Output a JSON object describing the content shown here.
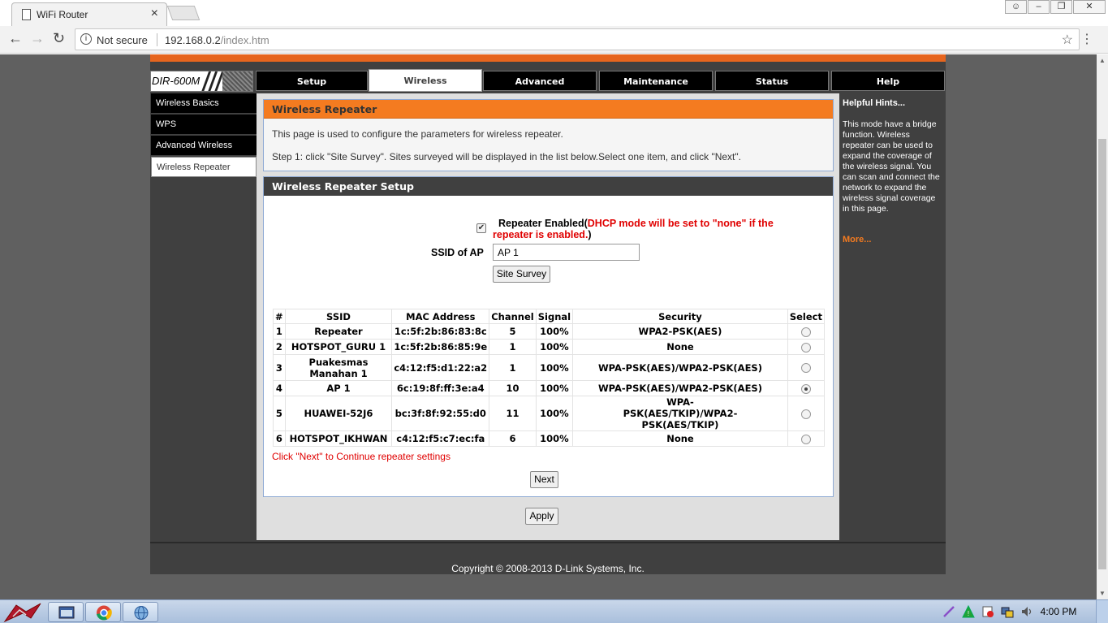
{
  "browser": {
    "tab_title": "WiFi Router",
    "tab_close": "×",
    "not_secure": "Not secure",
    "url_host": "192.168.0.2",
    "url_path": "/index.htm"
  },
  "router": {
    "model": "DIR-600M",
    "tabs": [
      "Setup",
      "Wireless",
      "Advanced",
      "Maintenance",
      "Status",
      "Help"
    ],
    "active_tab": "Wireless",
    "sidebar": [
      "Wireless Basics",
      "WPS",
      "Advanced Wireless",
      "Wireless Repeater"
    ],
    "active_sidebar": "Wireless Repeater",
    "intro": {
      "title": "Wireless Repeater",
      "line1": "This page is used to configure the parameters for wireless repeater.",
      "line2": "Step 1: click \"Site Survey\". Sites surveyed will be displayed in the list below.Select one item, and click \"Next\"."
    },
    "setup": {
      "title": "Wireless Repeater Setup",
      "repeater_enabled_checked": true,
      "repeater_label": "Repeater Enabled",
      "paren_open": "(",
      "warning_1": "DHCP mode will be set to \"none\" if the",
      "warning_2": "repeater is enabled.",
      "paren_close": ")",
      "ssid_label": "SSID of AP",
      "ssid_value": "AP 1",
      "site_survey_button": "Site Survey",
      "next_hint": "Click \"Next\" to Continue repeater settings",
      "next_button": "Next"
    },
    "table": {
      "headers": [
        "#",
        "SSID",
        "MAC Address",
        "Channel",
        "Signal",
        "Security",
        "Select"
      ],
      "rows": [
        {
          "num": "1",
          "ssid": "Repeater",
          "mac": "1c:5f:2b:86:83:8c",
          "channel": "5",
          "signal": "100%",
          "security": "WPA2-PSK(AES)",
          "selected": false
        },
        {
          "num": "2",
          "ssid": "HOTSPOT_GURU 1",
          "mac": "1c:5f:2b:86:85:9e",
          "channel": "1",
          "signal": "100%",
          "security": "None",
          "selected": false
        },
        {
          "num": "3",
          "ssid": "Puakesmas Manahan 1",
          "mac": "c4:12:f5:d1:22:a2",
          "channel": "1",
          "signal": "100%",
          "security": "WPA-PSK(AES)/WPA2-PSK(AES)",
          "selected": false
        },
        {
          "num": "4",
          "ssid": "AP 1",
          "mac": "6c:19:8f:ff:3e:a4",
          "channel": "10",
          "signal": "100%",
          "security": "WPA-PSK(AES)/WPA2-PSK(AES)",
          "selected": true
        },
        {
          "num": "5",
          "ssid": "HUAWEI-52J6",
          "mac": "bc:3f:8f:92:55:d0",
          "channel": "11",
          "signal": "100%",
          "security": "WPA-PSK(AES/TKIP)/WPA2-PSK(AES/TKIP)",
          "selected": false
        },
        {
          "num": "6",
          "ssid": "HOTSPOT_IKHWAN",
          "mac": "c4:12:f5:c7:ec:fa",
          "channel": "6",
          "signal": "100%",
          "security": "None",
          "selected": false
        }
      ]
    },
    "apply_button": "Apply",
    "hints": {
      "title": "Helpful Hints...",
      "body": "This mode have a bridge function. Wireless repeater can be used to expand the coverage of the wireless signal. You can scan and connect the network to expand the wireless signal coverage in this page.",
      "more": "More..."
    },
    "footer": "Copyright © 2008-2013 D-Link Systems, Inc."
  },
  "taskbar": {
    "clock": "4:00 PM"
  },
  "colors": {
    "accent_orange": "#f47b20",
    "dark_panel": "#404040",
    "warning_red": "#e00000"
  }
}
